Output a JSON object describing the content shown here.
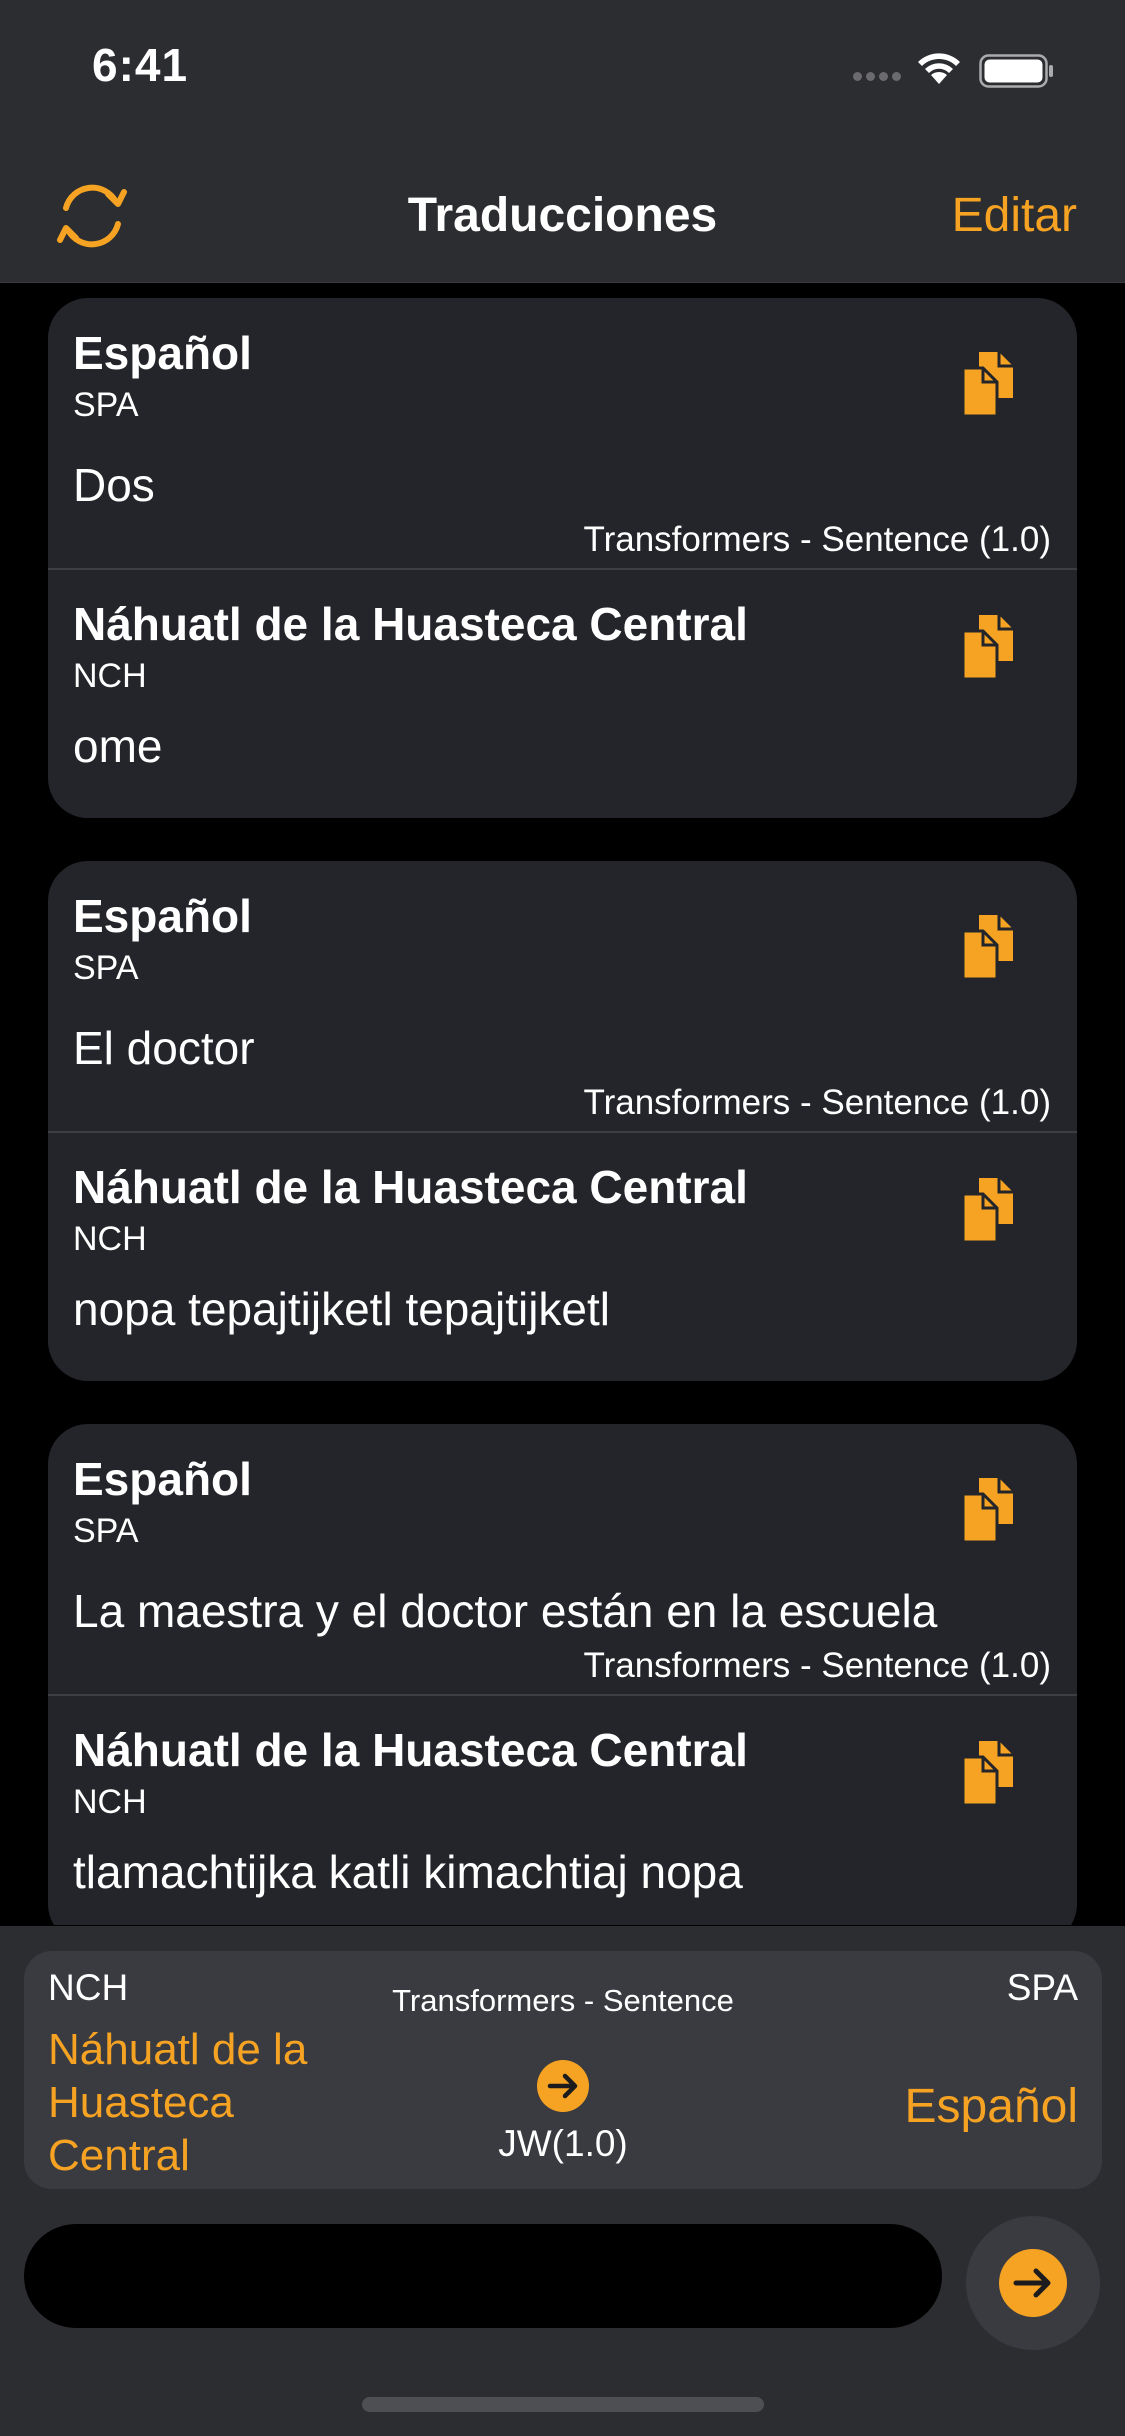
{
  "status_bar": {
    "time": "6:41"
  },
  "nav": {
    "title": "Traducciones",
    "edit_label": "Editar",
    "refresh_icon": "refresh-icon"
  },
  "colors": {
    "accent": "#f6a323",
    "card_bg": "#23252a",
    "header_bg": "#2c2d30"
  },
  "translations": [
    {
      "source": {
        "name": "Español",
        "code": "SPA",
        "text": "Dos"
      },
      "model": "Transformers - Sentence (1.0)",
      "target": {
        "name": "Náhuatl de la Huasteca Central",
        "code": "NCH",
        "text": "ome"
      }
    },
    {
      "source": {
        "name": "Español",
        "code": "SPA",
        "text": "El doctor"
      },
      "model": "Transformers - Sentence (1.0)",
      "target": {
        "name": "Náhuatl de la Huasteca Central",
        "code": "NCH",
        "text": "nopa tepajtijketl tepajtijketl"
      }
    },
    {
      "source": {
        "name": "Español",
        "code": "SPA",
        "text": "La maestra y el doctor están en la escuela"
      },
      "model": "Transformers - Sentence (1.0)",
      "target": {
        "name": "Náhuatl de la Huasteca Central",
        "code": "NCH",
        "text": "tlamachtijka katli kimachtiaj nopa"
      }
    }
  ],
  "language_selector": {
    "source_code": "NCH",
    "source_name": "Náhuatl de la Huasteca Central",
    "model_name": "Transformers - Sentence",
    "model_version": "JW(1.0)",
    "target_code": "SPA",
    "target_name": "Español"
  },
  "input": {
    "value": "",
    "placeholder": ""
  }
}
